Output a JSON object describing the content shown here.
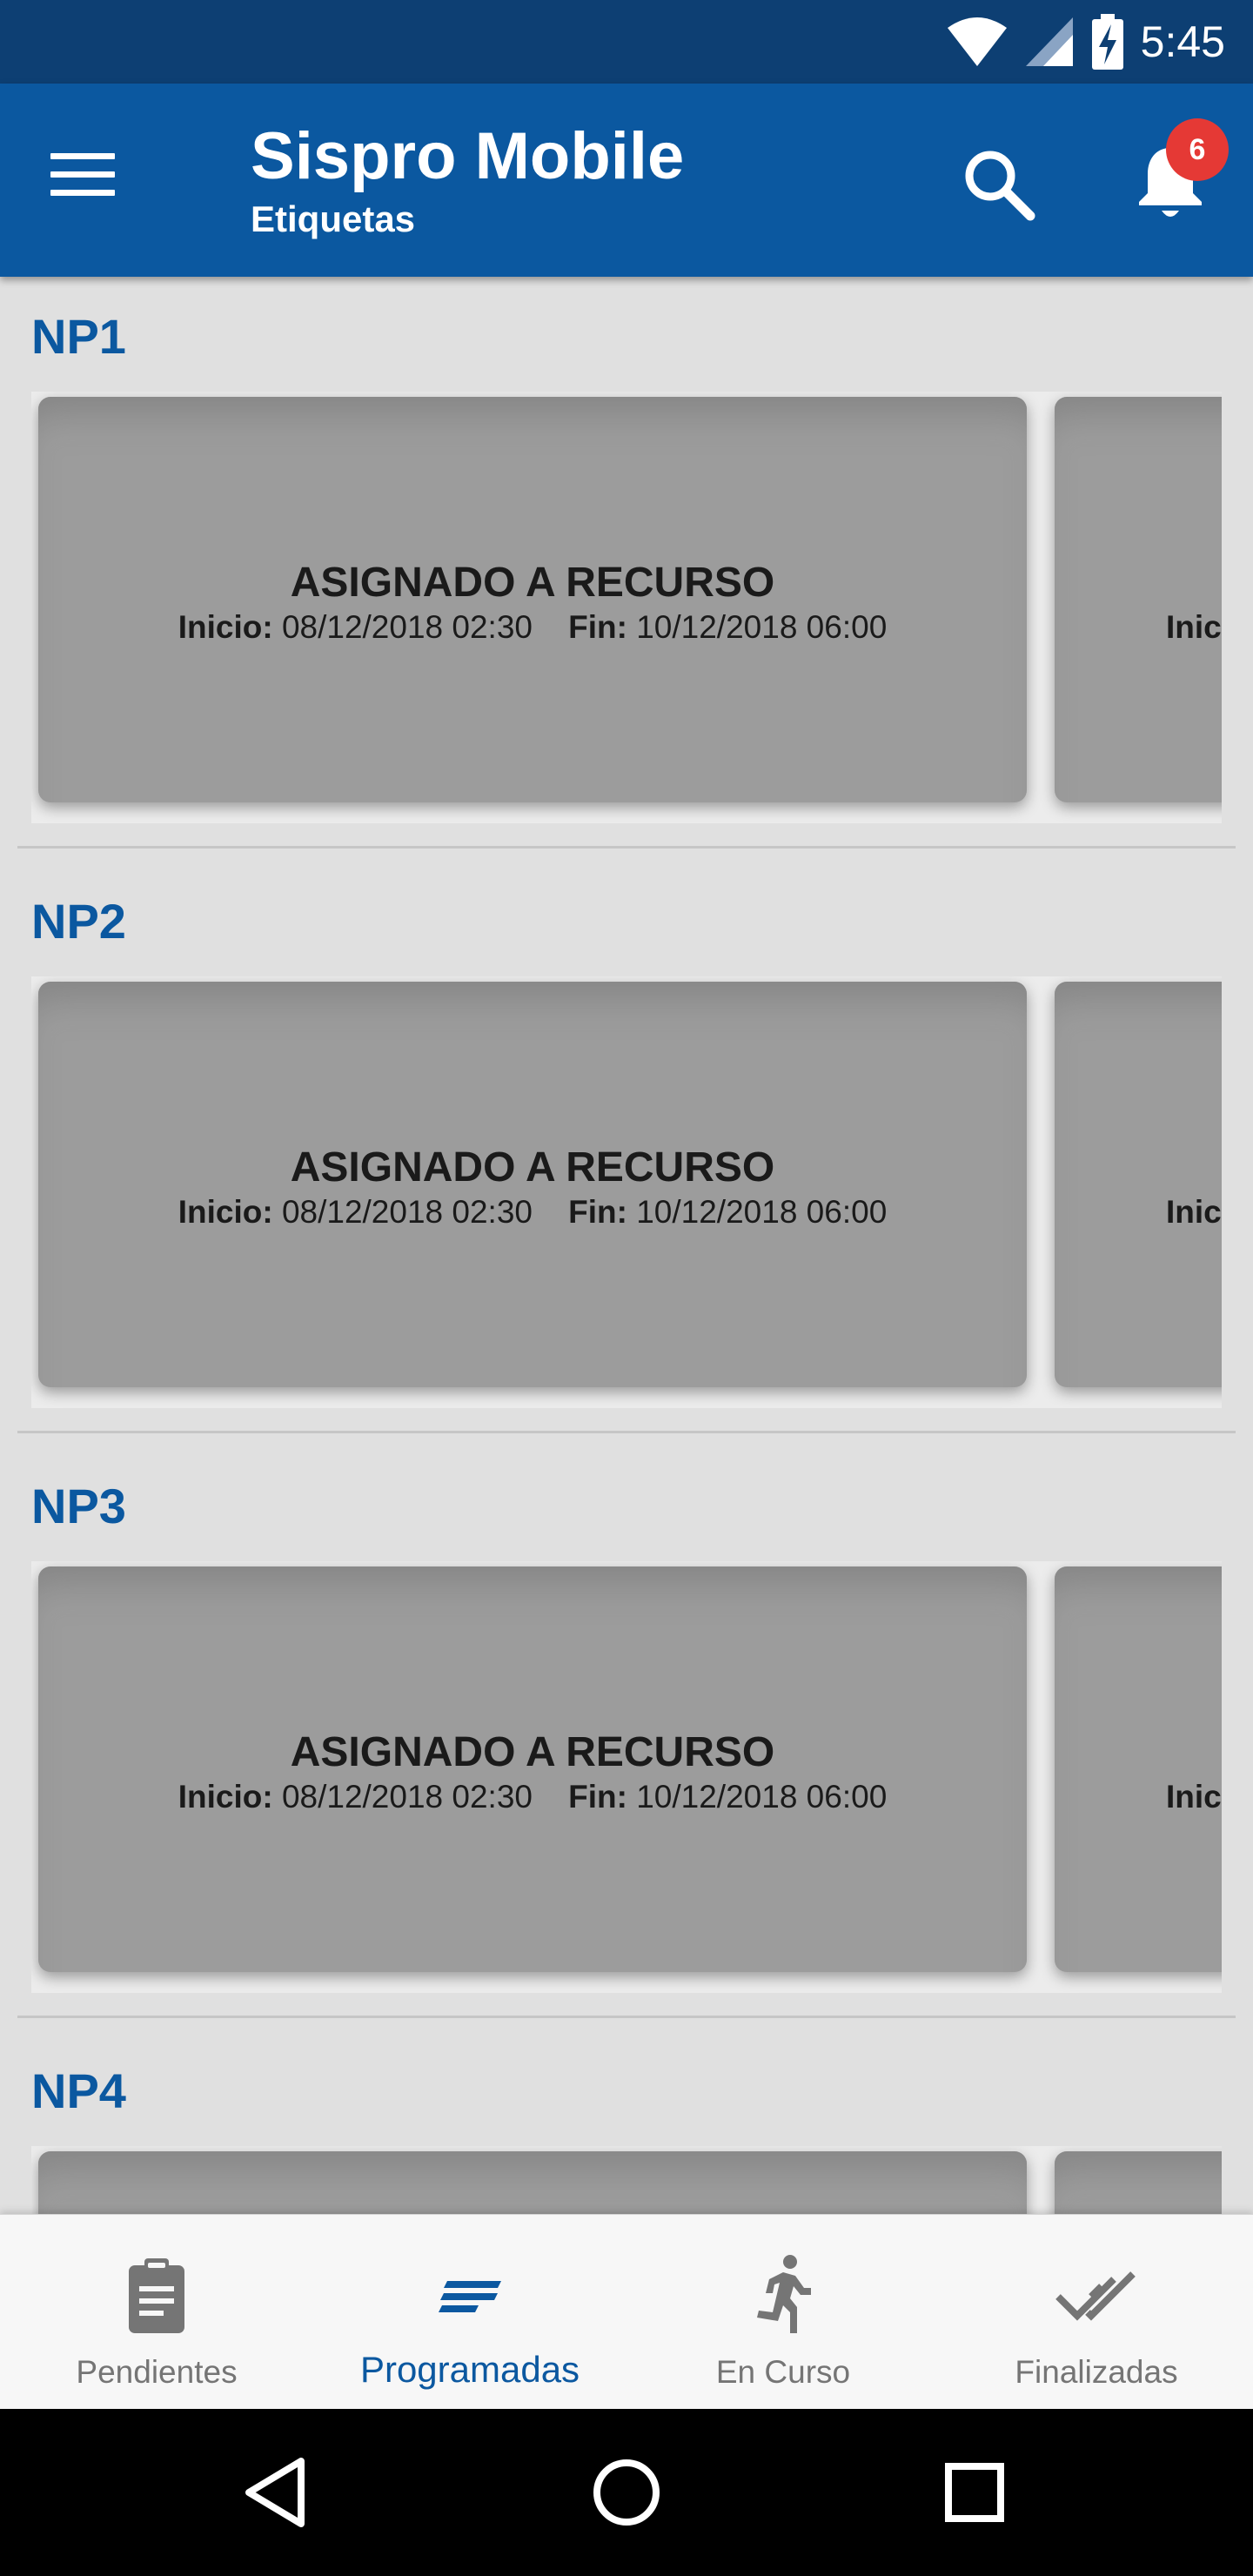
{
  "status_bar": {
    "time": "5:45",
    "icons": [
      "wifi-icon",
      "signal-icon",
      "battery-charging-icon"
    ]
  },
  "app_bar": {
    "title": "Sispro Mobile",
    "subtitle": "Etiquetas",
    "notification_count": "6",
    "accent": "#0b58a0"
  },
  "sections": [
    {
      "title": "NP1",
      "card": {
        "status": "ASIGNADO A RECURSO",
        "inicio_label": "Inicio:",
        "inicio": "08/12/2018 02:30",
        "fin_label": "Fin:",
        "fin": "10/12/2018 06:00"
      },
      "next_card_label": "Inic"
    },
    {
      "title": "NP2",
      "card": {
        "status": "ASIGNADO A RECURSO",
        "inicio_label": "Inicio:",
        "inicio": "08/12/2018 02:30",
        "fin_label": "Fin:",
        "fin": "10/12/2018 06:00"
      },
      "next_card_label": "Inic"
    },
    {
      "title": "NP3",
      "card": {
        "status": "ASIGNADO A RECURSO",
        "inicio_label": "Inicio:",
        "inicio": "08/12/2018 02:30",
        "fin_label": "Fin:",
        "fin": "10/12/2018 06:00"
      },
      "next_card_label": "Inic"
    },
    {
      "title": "NP4"
    }
  ],
  "bottom_nav": {
    "items": [
      {
        "label": "Pendientes",
        "icon": "clipboard-icon"
      },
      {
        "label": "Programadas",
        "icon": "sort-lines-icon",
        "active": true
      },
      {
        "label": "En Curso",
        "icon": "running-person-icon"
      },
      {
        "label": "Finalizadas",
        "icon": "double-check-icon"
      }
    ]
  },
  "system_nav": [
    "back-icon",
    "home-icon",
    "recents-icon"
  ]
}
